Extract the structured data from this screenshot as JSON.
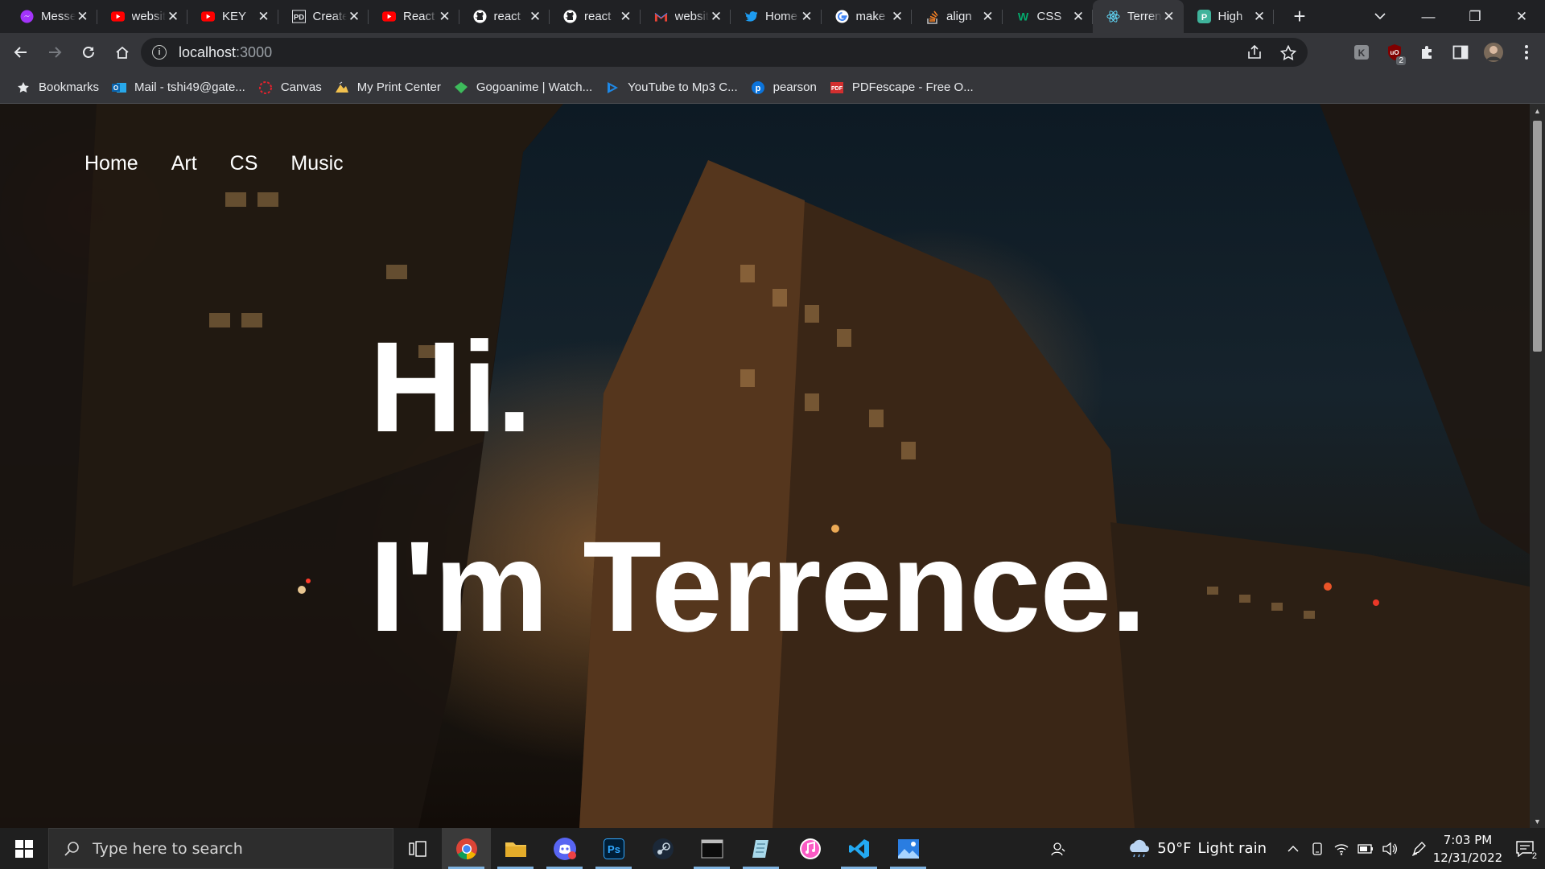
{
  "browser": {
    "tabs": [
      {
        "title": "Messenger",
        "icon": "messenger-icon",
        "color": "#a334fa",
        "active": false
      },
      {
        "title": "website",
        "icon": "youtube-icon",
        "color": "#ff0000",
        "active": false
      },
      {
        "title": "KEY",
        "icon": "youtube-icon",
        "color": "#ff0000",
        "active": false
      },
      {
        "title": "Create",
        "icon": "pd-icon",
        "color": "#e8eaed",
        "active": false
      },
      {
        "title": "React",
        "icon": "youtube-icon",
        "color": "#ff0000",
        "active": false
      },
      {
        "title": "react",
        "icon": "github-icon",
        "color": "#ffffff",
        "active": false
      },
      {
        "title": "react",
        "icon": "github-icon",
        "color": "#ffffff",
        "active": false
      },
      {
        "title": "website",
        "icon": "gmail-icon",
        "color": "#ea4335",
        "active": false
      },
      {
        "title": "Home",
        "icon": "twitter-icon",
        "color": "#1d9bf0",
        "active": false
      },
      {
        "title": "make",
        "icon": "google-icon",
        "color": "#ffffff",
        "active": false
      },
      {
        "title": "align",
        "icon": "stackoverflow-icon",
        "color": "#f48024",
        "active": false
      },
      {
        "title": "CSS",
        "icon": "w3schools-icon",
        "color": "#04aa6d",
        "active": false
      },
      {
        "title": "Terrence",
        "icon": "react-icon",
        "color": "#61dafb",
        "active": true
      },
      {
        "title": "High",
        "icon": "p-icon",
        "color": "#3fb39b",
        "active": false
      }
    ],
    "close_glyph": "✕",
    "new_tab_glyph": "+",
    "url_host": "localhost",
    "url_port": ":3000",
    "window_controls": {
      "minimize": "—",
      "restore": "❐",
      "close": "✕"
    },
    "extension_badge": "2"
  },
  "bookmarks": [
    {
      "label": "Bookmarks",
      "icon": "star-icon"
    },
    {
      "label": "Mail - tshi49@gate...",
      "icon": "outlook-icon"
    },
    {
      "label": "Canvas",
      "icon": "canvas-icon"
    },
    {
      "label": "My Print Center",
      "icon": "print-center-icon"
    },
    {
      "label": "Gogoanime | Watch...",
      "icon": "gogoanime-icon"
    },
    {
      "label": "YouTube to Mp3 C...",
      "icon": "play-icon"
    },
    {
      "label": "pearson",
      "icon": "pearson-icon"
    },
    {
      "label": "PDFescape - Free O...",
      "icon": "pdfescape-icon"
    }
  ],
  "page": {
    "nav": [
      "Home",
      "Art",
      "CS",
      "Music"
    ],
    "hero_line1": "Hi.",
    "hero_line2": "I'm Terrence."
  },
  "taskbar": {
    "search_placeholder": "Type here to search",
    "apps": [
      "chrome-icon",
      "file-explorer-icon",
      "discord-icon",
      "photoshop-icon",
      "steam-icon",
      "terminal-icon",
      "notepad-icon",
      "itunes-icon",
      "vscode-icon",
      "photos-icon"
    ],
    "weather_temp": "50°F",
    "weather_desc": "Light rain",
    "time": "7:03 PM",
    "date": "12/31/2022",
    "notification_count": "2"
  }
}
